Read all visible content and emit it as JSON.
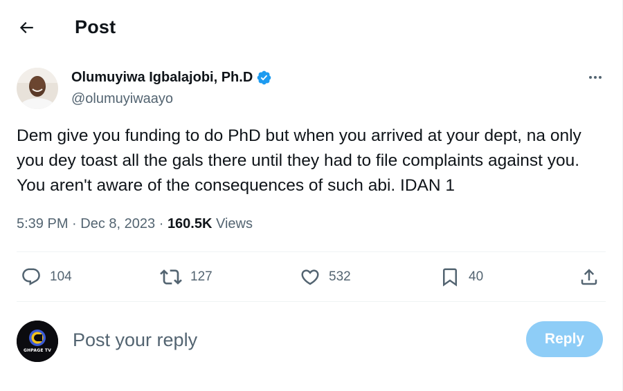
{
  "header": {
    "title": "Post"
  },
  "post": {
    "author": {
      "name": "Olumuyiwa Igbalajobi, Ph.D",
      "handle": "@olumuyiwaayo",
      "verified": true
    },
    "text": "Dem give you funding to do PhD but when you arrived at your dept, na only you dey toast all the gals there until they had to file complaints against you. You aren't aware of the consequences of such abi. IDAN 1",
    "time": "5:39 PM",
    "separator": "·",
    "date": "Dec 8, 2023",
    "views_count": "160.5K",
    "views_label": "Views",
    "stats": {
      "replies": "104",
      "reposts": "127",
      "likes": "532",
      "bookmarks": "40"
    }
  },
  "reply_composer": {
    "placeholder": "Post your reply",
    "button_label": "Reply",
    "avatar_text": "GHPAGE TV"
  },
  "colors": {
    "text_primary": "#0f1419",
    "text_secondary": "#536471",
    "verified_blue": "#1d9bf0",
    "reply_button_disabled": "#8ecdf7",
    "divider": "#eff3f4"
  },
  "icons": [
    "back-arrow-icon",
    "verified-badge-icon",
    "more-icon",
    "reply-icon",
    "repost-icon",
    "like-icon",
    "bookmark-icon",
    "share-icon"
  ]
}
